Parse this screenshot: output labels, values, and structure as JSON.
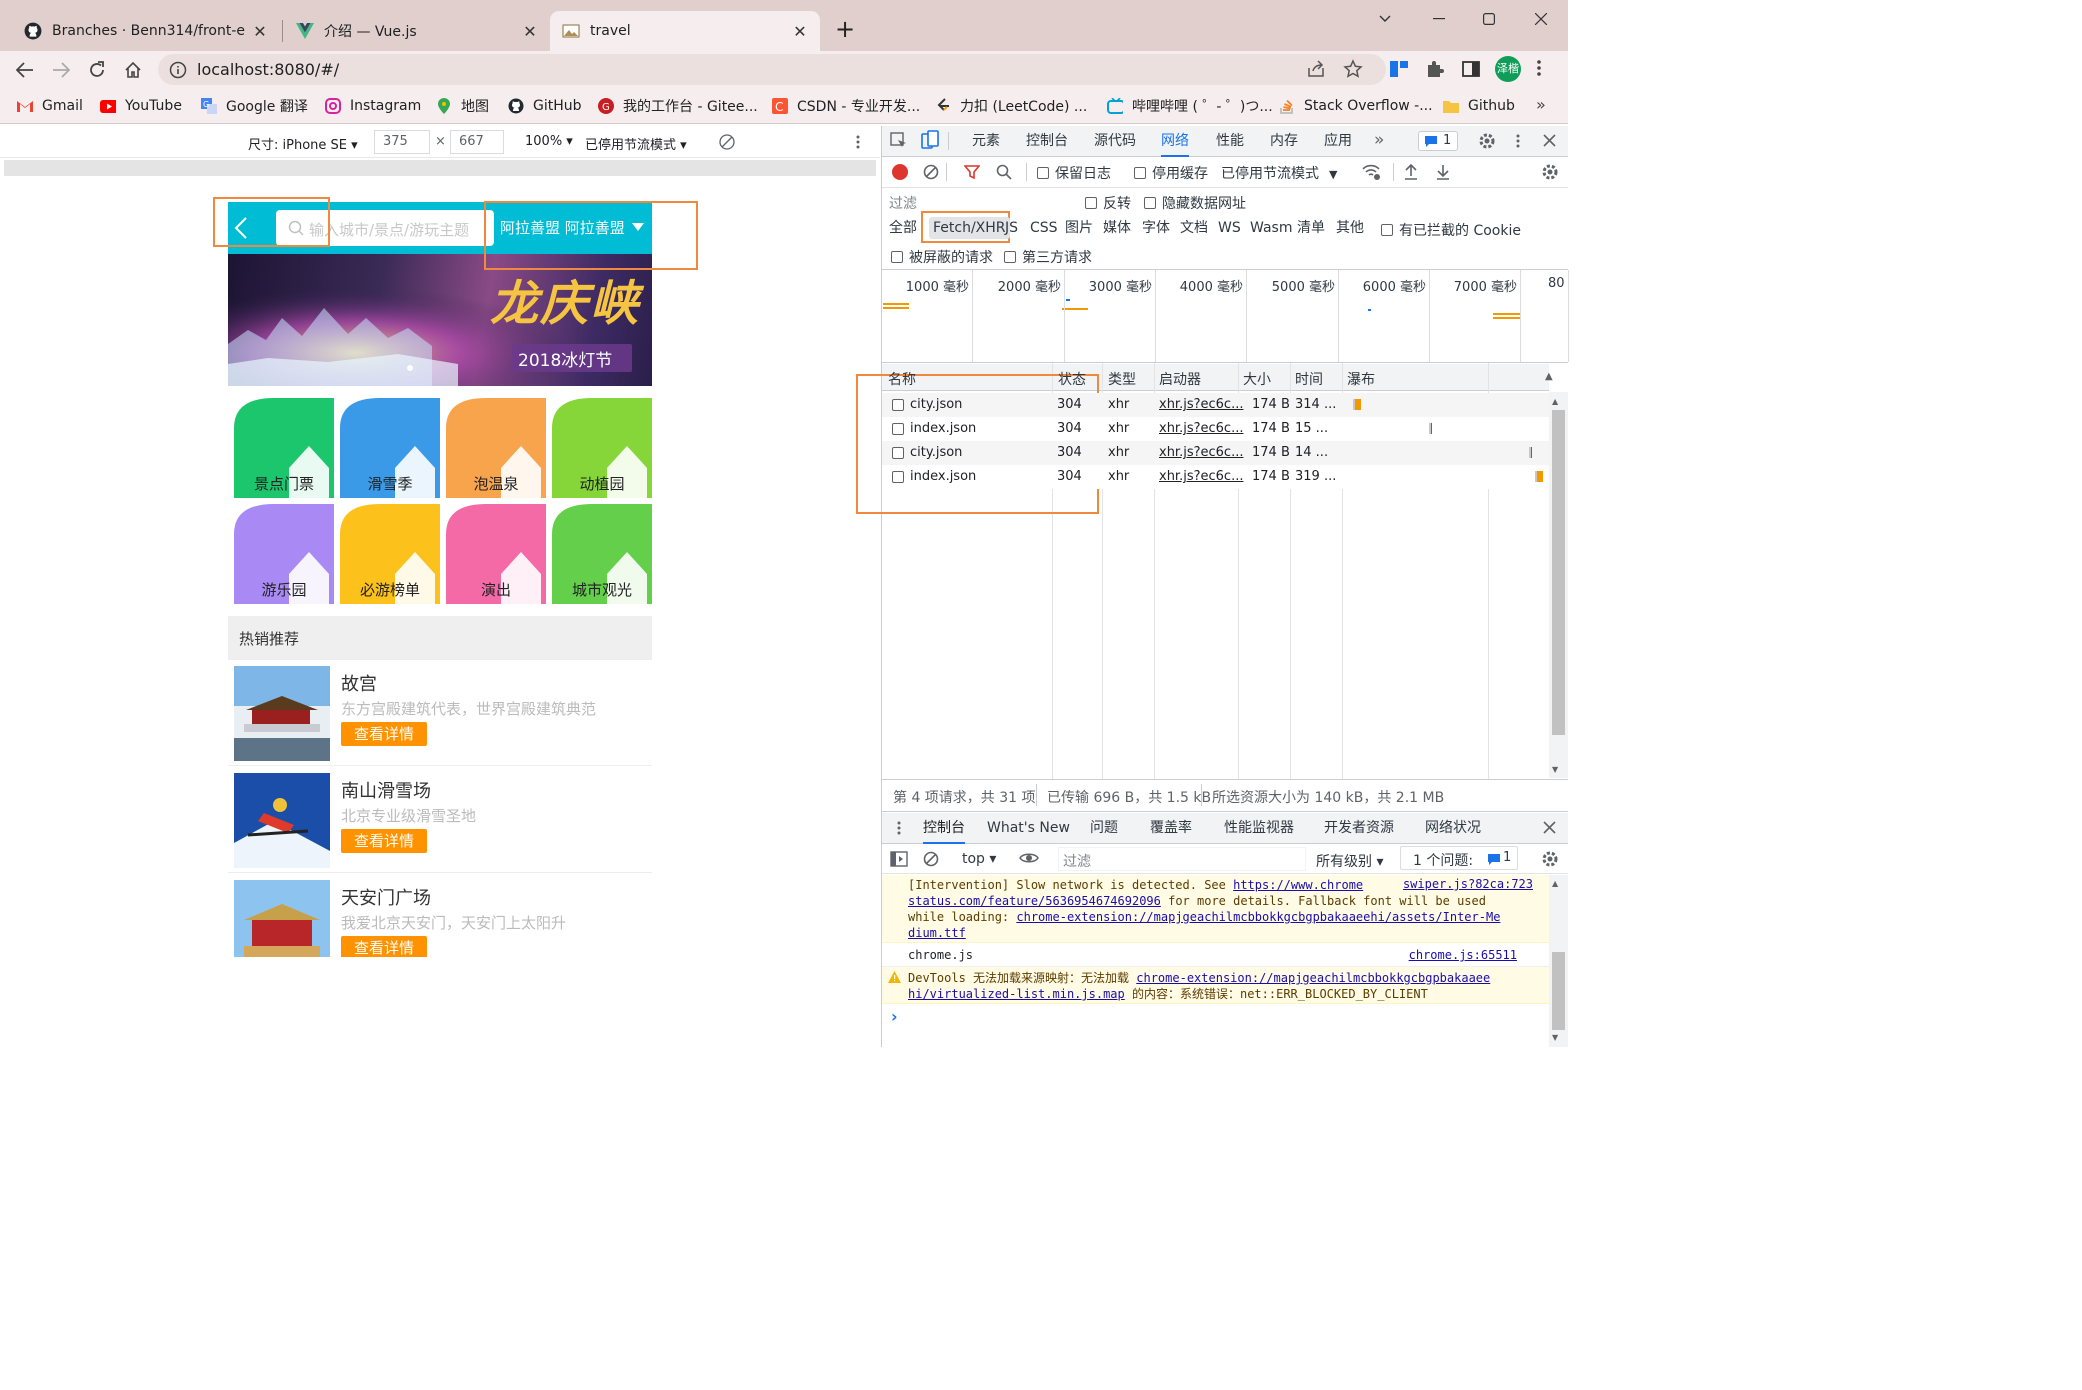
{
  "browser": {
    "tabs": [
      {
        "title": "Branches · Benn314/front-end",
        "icon": "github-icon",
        "active": false
      },
      {
        "title": "介绍 — Vue.js",
        "icon": "vue-icon",
        "active": false
      },
      {
        "title": "travel",
        "icon": "travel-icon",
        "active": true
      }
    ],
    "new_tab": "+",
    "url": "localhost:8080/#/",
    "profile_badge": "泽楷",
    "bookmarks": [
      {
        "label": "Gmail",
        "icon": "gmail-icon",
        "color": "#ea4335"
      },
      {
        "label": "YouTube",
        "icon": "youtube-icon",
        "color": "#ff0000"
      },
      {
        "label": "Google 翻译",
        "icon": "translate-icon",
        "color": "#4285f4"
      },
      {
        "label": "Instagram",
        "icon": "instagram-icon",
        "color": "#d6249f"
      },
      {
        "label": "地图",
        "icon": "maps-icon",
        "color": "#34a853"
      },
      {
        "label": "GitHub",
        "icon": "github-icon",
        "color": "#24292f"
      },
      {
        "label": "我的工作台 - Gitee...",
        "icon": "gitee-icon",
        "color": "#c71d23"
      },
      {
        "label": "CSDN - 专业开发...",
        "icon": "csdn-icon",
        "color": "#fc5531"
      },
      {
        "label": "力扣 (LeetCode) ...",
        "icon": "leetcode-icon",
        "color": "#ffa116"
      },
      {
        "label": "哔哩哔哩 ( ゜- ゜)つ...",
        "icon": "bilibili-icon",
        "color": "#00a1d6"
      },
      {
        "label": "Stack Overflow -...",
        "icon": "stackoverflow-icon",
        "color": "#f48024"
      },
      {
        "label": "Github",
        "icon": "folder-icon",
        "color": "#f5c542"
      }
    ],
    "bookmarks_more": "»"
  },
  "device_toolbar": {
    "dimensions_label": "尺寸: iPhone SE ▾",
    "width": "375",
    "times": "×",
    "height": "667",
    "zoom": "100% ▾",
    "throttle": "已停用节流模式 ▾"
  },
  "app": {
    "search_placeholder": "输入城市/景点/游玩主题",
    "city": "阿拉善盟 阿拉善盟",
    "banner_title": "龙庆峡",
    "banner_sub": "2018冰灯节",
    "categories": [
      {
        "label": "景点门票",
        "color": "#1cc66d"
      },
      {
        "label": "滑雪季",
        "color": "#3b9ae8"
      },
      {
        "label": "泡温泉",
        "color": "#f8a44c"
      },
      {
        "label": "动植园",
        "color": "#86d63a"
      },
      {
        "label": "游乐园",
        "color": "#a98af5"
      },
      {
        "label": "必游榜单",
        "color": "#fcc11a"
      },
      {
        "label": "演出",
        "color": "#f46aa6"
      },
      {
        "label": "城市观光",
        "color": "#63cf4a"
      }
    ],
    "hot_title": "热销推荐",
    "hot_items": [
      {
        "title": "故宫",
        "desc": "东方宫殿建筑代表，世界宫殿建筑典范",
        "button": "查看详情"
      },
      {
        "title": "南山滑雪场",
        "desc": "北京专业级滑雪圣地",
        "button": "查看详情"
      },
      {
        "title": "天安门广场",
        "desc": "我爱北京天安门，天安门上太阳升",
        "button": "查看详情"
      }
    ]
  },
  "devtools": {
    "tabs": [
      "元素",
      "控制台",
      "源代码",
      "网络",
      "性能",
      "内存",
      "应用"
    ],
    "active_tab": "网络",
    "more": "»",
    "issues_badge": "1",
    "preserve_log": "保留日志",
    "disable_cache": "停用缓存",
    "throttle": "已停用节流模式",
    "filter_label": "过滤",
    "invert": "反转",
    "hide_data_urls": "隐藏数据网址",
    "type_filters": [
      "全部",
      "Fetch/XHR",
      "JS",
      "CSS",
      "图片",
      "媒体",
      "字体",
      "文档",
      "WS",
      "Wasm",
      "清单",
      "其他"
    ],
    "active_type": "Fetch/XHR",
    "blocked_cookies": "有已拦截的 Cookie",
    "blocked_requests": "被屏蔽的请求",
    "third_party": "第三方请求",
    "timeline_ticks": [
      "1000 毫秒",
      "2000 毫秒",
      "3000 毫秒",
      "4000 毫秒",
      "5000 毫秒",
      "6000 毫秒",
      "7000 毫秒",
      "80"
    ],
    "columns": [
      "名称",
      "状态",
      "类型",
      "启动器",
      "大小",
      "时间",
      "瀑布"
    ],
    "requests": [
      {
        "name": "city.json",
        "status": "304",
        "type": "xhr",
        "initiator": "xhr.js?ec6c...",
        "size": "174 B",
        "time": "314 ...",
        "wf_start": 0.04,
        "wf_color": "#f29900"
      },
      {
        "name": "index.json",
        "status": "304",
        "type": "xhr",
        "initiator": "xhr.js?ec6c...",
        "size": "174 B",
        "time": "15 ...",
        "wf_start": 0.44,
        "wf_color": "#1a73e8"
      },
      {
        "name": "city.json",
        "status": "304",
        "type": "xhr",
        "initiator": "xhr.js?ec6c...",
        "size": "174 B",
        "time": "14 ...",
        "wf_start": 0.96,
        "wf_color": "#1a73e8"
      },
      {
        "name": "index.json",
        "status": "304",
        "type": "xhr",
        "initiator": "xhr.js?ec6c...",
        "size": "174 B",
        "time": "319 ...",
        "wf_start": 0.99,
        "wf_color": "#f29900"
      }
    ],
    "status_bar": [
      "第 4 项请求，共 31 项",
      "已传输 696 B，共 1.5 kB",
      "所选资源大小为 140 kB，共 2.1 MB"
    ],
    "drawer_tabs": [
      "控制台",
      "What's New",
      "问题",
      "覆盖率",
      "性能监视器",
      "开发者资源",
      "网络状况"
    ],
    "console_context": "top ▾",
    "console_filter": "过滤",
    "levels": "所有级别 ▾",
    "issues_text": "1 个问题:",
    "issues_count": "1",
    "messages": {
      "warn1_l1": "[Intervention] Slow network is detected. See ",
      "warn1_link1": "https://www.chrome",
      "warn1_src": "swiper.js?82ca:723",
      "warn1_link1b": "status.com/feature/5636954674692096",
      "warn1_l2b": " for more details. Fallback font will be used",
      "warn1_l3": "while loading: ",
      "warn1_link2": "chrome-extension://mapjgeachilmcbbokkgcbgpbakaaeehi/assets/Inter-Me",
      "warn1_link2b": "dium.ttf",
      "log_text": "chrome.js",
      "log_src": "chrome.js:65511",
      "warn2_l1": "DevTools 无法加载来源映射：无法加载 ",
      "warn2_link": "chrome-extension://mapjgeachilmcbbokkgcbgpbakaaee",
      "warn2_linkb": "hi/virtualized-list.min.js.map",
      "warn2_l2": " 的内容：系统错误：net::ERR_BLOCKED_BY_CLIENT",
      "prompt": "›"
    }
  }
}
